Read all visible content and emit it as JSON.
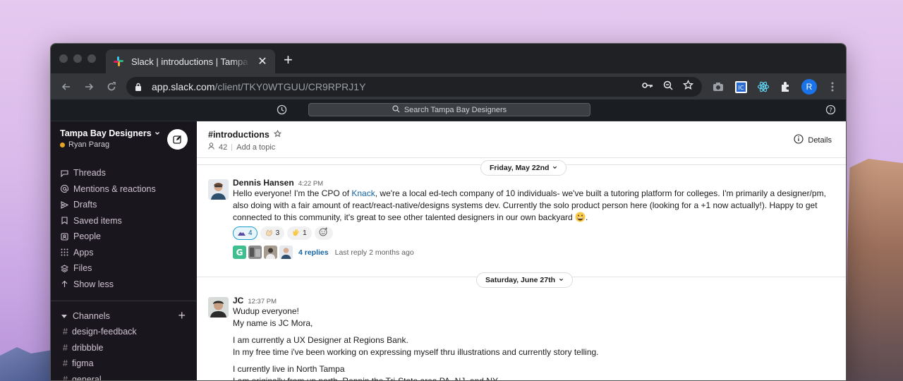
{
  "browser": {
    "tab_title": "Slack | introductions | Tampa Bay Designers",
    "url_host": "app.slack.com",
    "url_path": "/client/TKY0WTGUU/CR9RPRJ1Y",
    "profile_initial": "R"
  },
  "slack_top": {
    "search_placeholder": "Search Tampa Bay Designers"
  },
  "sidebar": {
    "workspace_name": "Tampa Bay Designers",
    "user_name": "Ryan Parag",
    "nav": [
      {
        "label": "Threads",
        "icon": "threads-icon"
      },
      {
        "label": "Mentions & reactions",
        "icon": "at-sign-icon"
      },
      {
        "label": "Drafts",
        "icon": "drafts-icon"
      },
      {
        "label": "Saved items",
        "icon": "bookmark-icon"
      },
      {
        "label": "People",
        "icon": "people-icon"
      },
      {
        "label": "Apps",
        "icon": "apps-grid-icon"
      },
      {
        "label": "Files",
        "icon": "files-icon"
      },
      {
        "label": "Show less",
        "icon": "arrow-up-icon"
      }
    ],
    "channels_title": "Channels",
    "channels": [
      "design-feedback",
      "dribbble",
      "figma",
      "general"
    ]
  },
  "channel": {
    "name": "#introductions",
    "member_count": "42",
    "topic_placeholder": "Add a topic",
    "details_label": "Details"
  },
  "feed": {
    "day1": "Friday, May 22nd",
    "day2": "Saturday, June 27th",
    "msg1": {
      "author": "Dennis Hansen",
      "time": "4:22 PM",
      "text_before_link": "Hello everyone! I'm the CPO of ",
      "link": "Knack",
      "text_after_link": ", we're a local ed-tech company of 10 individuals- we've built a tutoring platform for colleges. I'm primarily a designer/pm, also doing with a fair amount of react/react-native/designs systems dev. Currently the solo product person here (looking for a +1 now actually!). Happy to get connected to this community, it's great to see other talented designers in our own backyard ",
      "text_end": ".",
      "reactions": [
        {
          "count": "4",
          "active": true
        },
        {
          "count": "3",
          "active": false
        },
        {
          "count": "1",
          "active": false
        }
      ],
      "replies": "4 replies",
      "last_reply": "Last reply 2 months ago"
    },
    "msg2": {
      "author": "JC",
      "time": "12:37 PM",
      "lines": [
        "Wudup everyone!",
        "My name is JC Mora,",
        "I am currently a UX Designer at Regions Bank.",
        "In my free time i've been working on expressing myself thru illustrations and currently story telling.",
        "I currently live in North Tampa",
        "I am originally from up north. Reppin the Tri-State area PA, NJ, and NY"
      ]
    }
  },
  "colors": {
    "sidebar_bg": "#19171d",
    "topbar_bg": "#1a1d21",
    "link": "#1264a3",
    "presence": "#e8a723",
    "slack_logo": [
      "#e01e5a",
      "#36c5f0",
      "#2eb67d",
      "#ecb22e"
    ]
  }
}
